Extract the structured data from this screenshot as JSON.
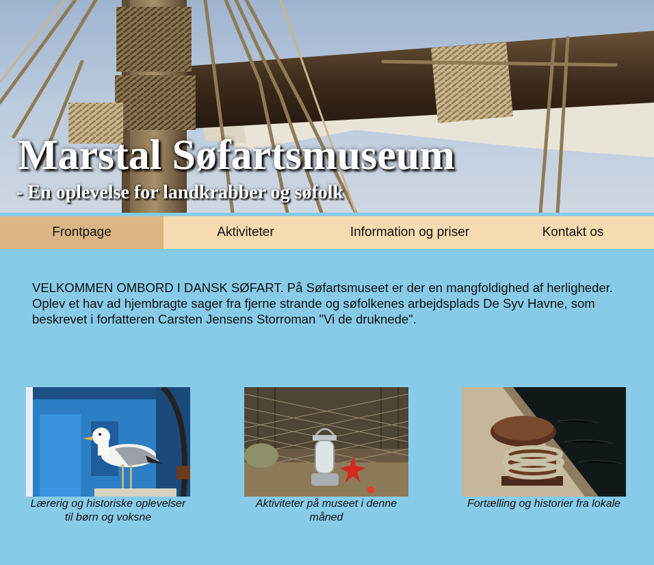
{
  "header": {
    "title": "Marstal Søfartsmuseum",
    "subtitle": "- En oplevelse for landkrabber og søfolk",
    "image_icon": "ship-mast-ropes-image"
  },
  "nav": {
    "items": [
      {
        "label": "Frontpage",
        "active": true
      },
      {
        "label": "Aktiviteter",
        "active": false
      },
      {
        "label": "Information og priser",
        "active": false
      },
      {
        "label": "Kontakt os",
        "active": false
      }
    ]
  },
  "main": {
    "intro": "VELKOMMEN OMBORD I DANSK SØFART. På Søfartsmuseet er der en mangfoldighed af herligheder. Oplev et hav ad hjembragte sager fra fjerne strande og søfolkenes arbejdsplads De Syv Havne, som beskrevet i forfatteren Carsten Jensens Storroman \"Vi de druknede\"."
  },
  "cards": [
    {
      "caption": "Lærerig og historiske oplevelser til børn og voksne",
      "image": "seagull-photo"
    },
    {
      "caption": "Aktiviteter på museet i denne måned",
      "image": "lantern-net-photo"
    },
    {
      "caption": "Fortælling og historier fra lokale",
      "image": "bollard-rope-photo"
    }
  ],
  "colors": {
    "background": "#87cbe9",
    "nav": "#f5dcb0",
    "nav_active": "#dcb585"
  }
}
